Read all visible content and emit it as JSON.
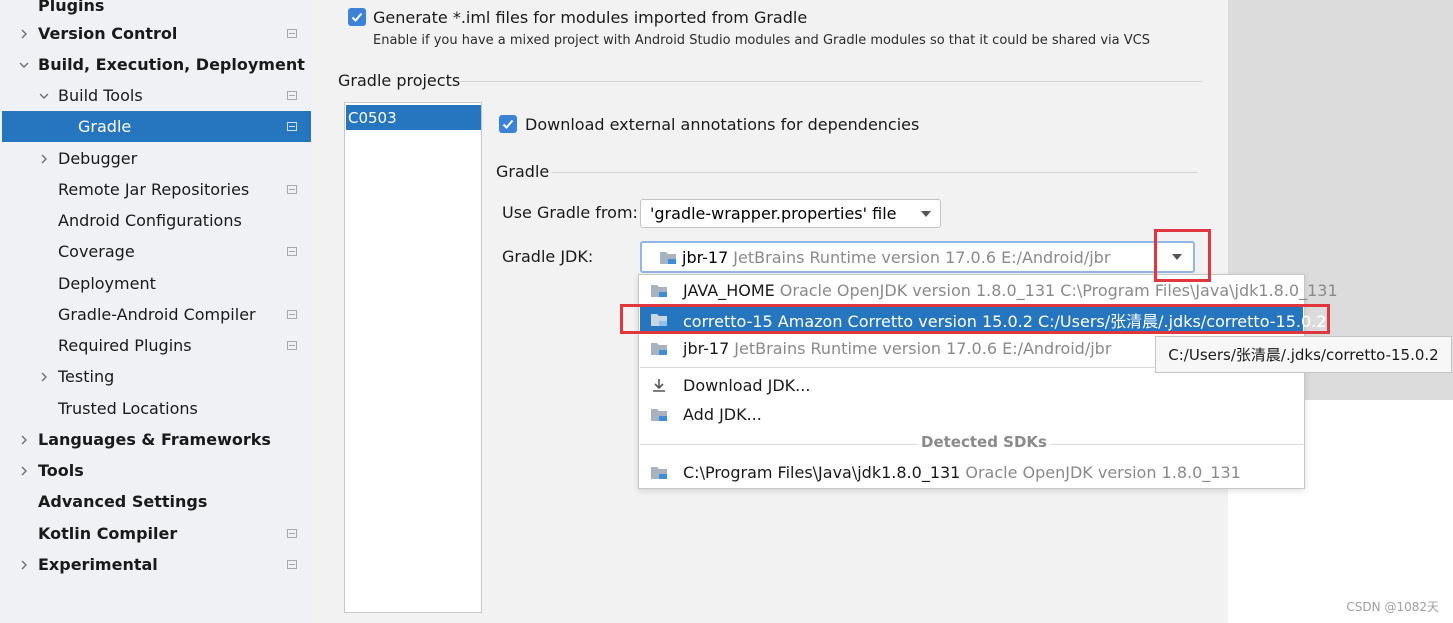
{
  "sidebar": {
    "items": [
      {
        "label": "Plugins",
        "bold": true
      },
      {
        "label": "Version Control",
        "bold": true,
        "chevron": "right"
      },
      {
        "label": "Build, Execution, Deployment",
        "bold": true,
        "chevron": "down"
      },
      {
        "label": "Build Tools",
        "chevron": "down"
      },
      {
        "label": "Gradle",
        "selected": true
      },
      {
        "label": "Debugger",
        "chevron": "right"
      },
      {
        "label": "Remote Jar Repositories"
      },
      {
        "label": "Android Configurations"
      },
      {
        "label": "Coverage"
      },
      {
        "label": "Deployment"
      },
      {
        "label": "Gradle-Android Compiler"
      },
      {
        "label": "Required Plugins"
      },
      {
        "label": "Testing",
        "chevron": "right"
      },
      {
        "label": "Trusted Locations"
      },
      {
        "label": "Languages & Frameworks",
        "bold": true,
        "chevron": "right"
      },
      {
        "label": "Tools",
        "bold": true,
        "chevron": "right"
      },
      {
        "label": "Advanced Settings",
        "bold": true
      },
      {
        "label": "Kotlin Compiler",
        "bold": true
      },
      {
        "label": "Experimental",
        "bold": true,
        "chevron": "right"
      }
    ]
  },
  "main": {
    "generate_iml": {
      "label": "Generate *.iml files for modules imported from Gradle",
      "hint": "Enable if you have a mixed project with Android Studio modules and Gradle modules so that it could be shared via VCS",
      "checked": true
    },
    "gradle_projects_title": "Gradle projects",
    "projects": [
      "C0503"
    ],
    "download_annotations": {
      "label": "Download external annotations for dependencies",
      "checked": true
    },
    "gradle_section_title": "Gradle",
    "use_gradle_from": {
      "label": "Use Gradle from:",
      "value": "'gradle-wrapper.properties' file"
    },
    "gradle_jdk": {
      "label": "Gradle JDK:",
      "name": "jbr-17",
      "desc": "JetBrains Runtime version 17.0.6 E:/Android/jbr"
    }
  },
  "popup": {
    "jdks": [
      {
        "name": "JAVA_HOME",
        "desc": "Oracle OpenJDK version 1.8.0_131 C:\\Program Files\\Java\\jdk1.8.0_131"
      },
      {
        "name": "corretto-15 Amazon Corretto version 15.0.2 C:/Users/张清晨/.jdks/corretto-15.0.2",
        "desc": "",
        "selected": true
      },
      {
        "name": "jbr-17",
        "desc": "JetBrains Runtime version 17.0.6 E:/Android/jbr"
      }
    ],
    "download_jdk": "Download JDK...",
    "add_jdk": "Add JDK...",
    "detected_title": "Detected SDKs",
    "detected": [
      {
        "name": "C:\\Program Files\\Java\\jdk1.8.0_131",
        "desc": "Oracle OpenJDK version 1.8.0_131"
      }
    ]
  },
  "tooltip": "C:/Users/张清晨/.jdks/corretto-15.0.2",
  "watermark": "CSDN @1082天",
  "colors": {
    "accent": "#2675bf",
    "checkbox": "#3c82d6",
    "highlight_box": "#e0363e"
  }
}
